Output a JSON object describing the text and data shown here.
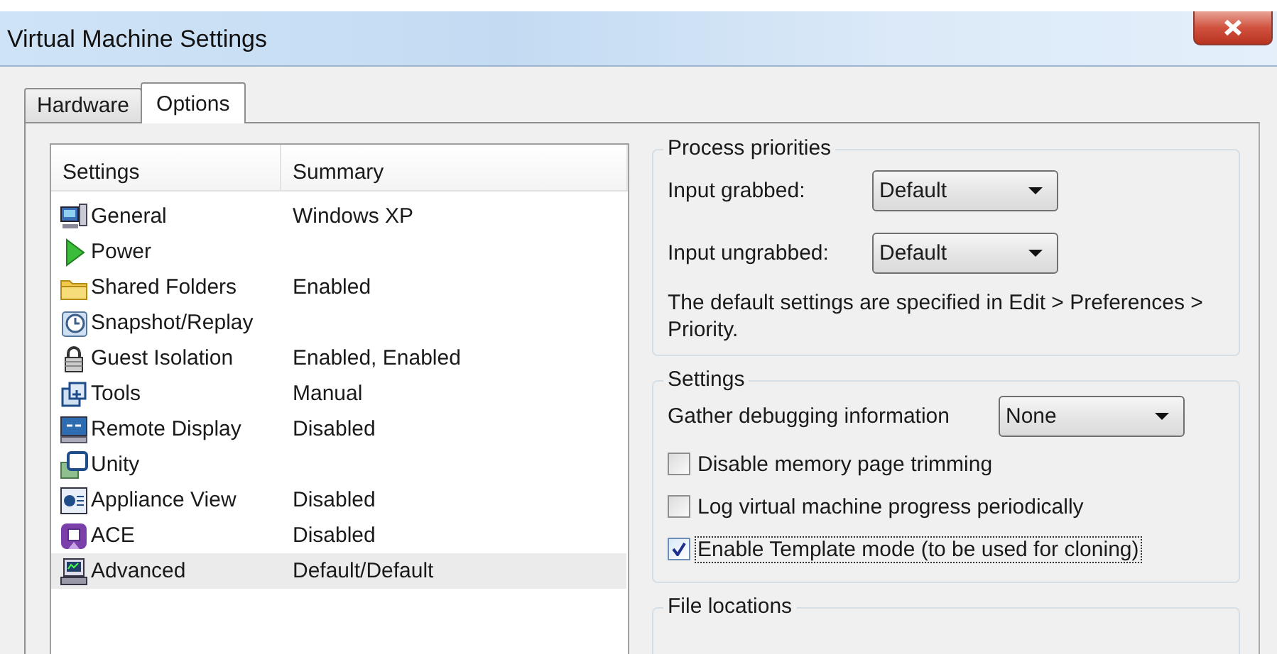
{
  "window": {
    "title": "Virtual Machine Settings"
  },
  "tabs": [
    {
      "label": "Hardware",
      "selected": false
    },
    {
      "label": "Options",
      "selected": true
    }
  ],
  "settings_list": {
    "columns": [
      "Settings",
      "Summary"
    ],
    "rows": [
      {
        "name": "General",
        "summary": "Windows XP",
        "selected": false
      },
      {
        "name": "Power",
        "selected": false
      },
      {
        "name": "Shared Folders",
        "summary": "Enabled",
        "selected": false
      },
      {
        "name": "Snapshot/Replay",
        "selected": false
      },
      {
        "name": "Guest Isolation",
        "summary": "Enabled, Enabled",
        "selected": false
      },
      {
        "name": "Tools",
        "summary": "Manual",
        "selected": false
      },
      {
        "name": "Remote Display",
        "summary": "Disabled",
        "selected": false
      },
      {
        "name": "Unity",
        "selected": false
      },
      {
        "name": "Appliance View",
        "summary": "Disabled",
        "selected": false
      },
      {
        "name": "ACE",
        "summary": "Disabled",
        "selected": false
      },
      {
        "name": "Advanced",
        "summary": "Default/Default",
        "selected": true
      }
    ]
  },
  "groups": [
    {
      "title": "Process priorities",
      "items": [
        {
          "kind": "dropdown",
          "label": "Input grabbed:",
          "value": "Default"
        },
        {
          "kind": "dropdown",
          "label": "Input ungrabbed:",
          "value": "Default"
        },
        {
          "kind": "note",
          "text": "The default settings are specified in Edit > Preferences > Priority."
        }
      ]
    },
    {
      "title": "Settings",
      "items": [
        {
          "kind": "dropdown",
          "label": "Gather debugging information",
          "value": "None"
        },
        {
          "kind": "checkbox",
          "label": "Disable memory page trimming",
          "checked": false,
          "focused": false
        },
        {
          "kind": "checkbox",
          "label": "Log virtual machine progress periodically",
          "checked": false,
          "focused": false
        },
        {
          "kind": "checkbox",
          "label": "Enable Template mode (to be used for cloning)",
          "checked": true,
          "focused": true
        }
      ]
    },
    {
      "title": "File locations"
    }
  ]
}
